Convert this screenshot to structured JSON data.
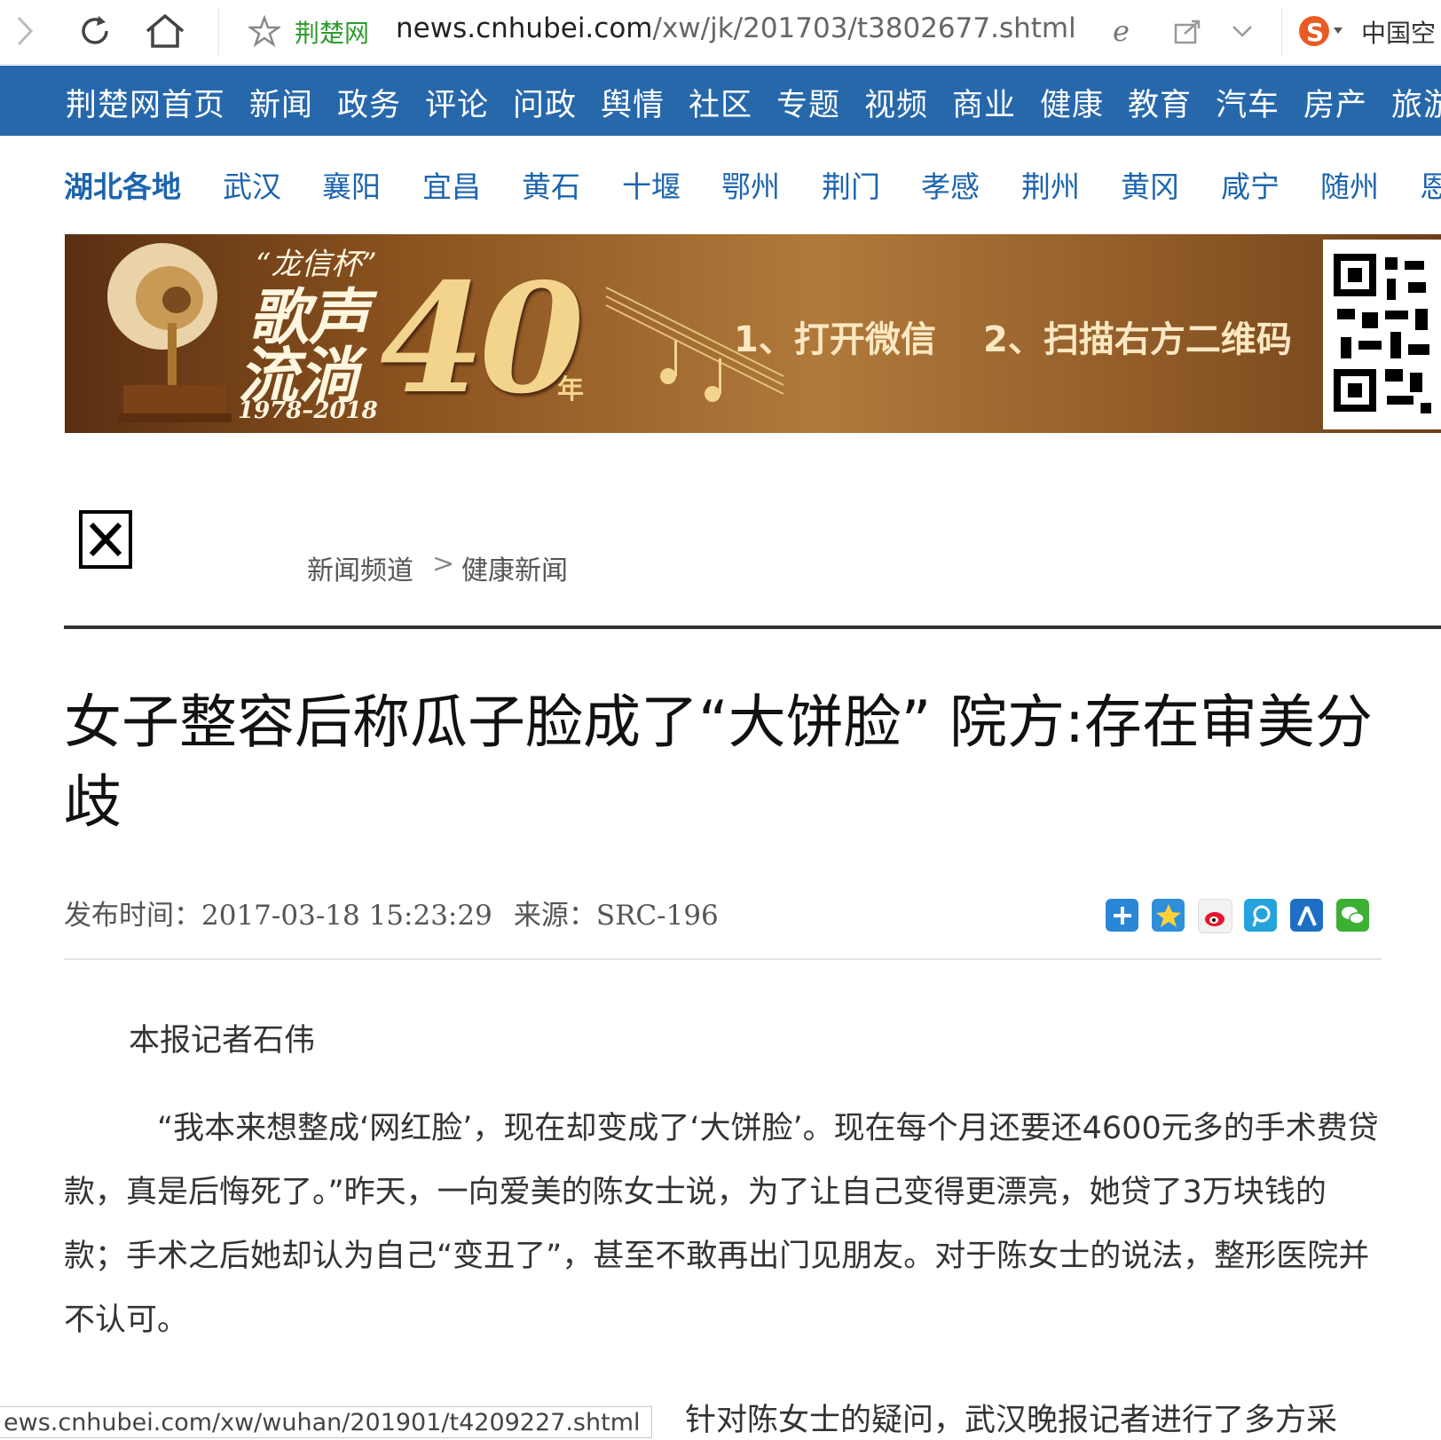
{
  "browser": {
    "site_name": "荆楚网",
    "url_host": "news.cnhubei.com",
    "url_path": "/xw/jk/201703/t3802677.shtml",
    "search_text": "中国空"
  },
  "main_nav": [
    "荆楚网首页",
    "新闻",
    "政务",
    "评论",
    "问政",
    "舆情",
    "社区",
    "专题",
    "视频",
    "商业",
    "健康",
    "教育",
    "汽车",
    "房产",
    "旅游"
  ],
  "region_nav": {
    "title": "湖北各地",
    "items": [
      "武汉",
      "襄阳",
      "宜昌",
      "黄石",
      "十堰",
      "鄂州",
      "荆门",
      "孝感",
      "荆州",
      "黄冈",
      "咸宁",
      "随州",
      "恩"
    ]
  },
  "banner": {
    "cup": "“龙信杯”",
    "slogan_1": "歌声",
    "slogan_2": "流淌",
    "years": "1978–2018",
    "big_number": "40",
    "nian": "年",
    "step_1": "1、打开微信",
    "step_2": "2、扫描右方二维码"
  },
  "breadcrumb": {
    "channel": "新闻频道",
    "separator": ">",
    "section": "健康新闻"
  },
  "article": {
    "title": "女子整容后称瓜子脸成了“大饼脸” 院方:存在审美分歧",
    "publish_label": "发布时间：",
    "publish_time": "2017-03-18 15:23:29",
    "source_label": "来源：",
    "source": "SRC-196",
    "byline": "本报记者石伟",
    "paragraph_1": "“我本来想整成‘网红脸’，现在却变成了‘大饼脸’。现在每个月还要还4600元多的手术费贷款，真是后悔死了。”昨天，一向爱美的陈女士说，为了让自己变得更漂亮，她贷了3万块钱的款；手术之后她却认为自己“变丑了”，甚至不敢再出门见朋友。对于陈女士的说法，整形医院并不认可。",
    "paragraph_2_partial": "针对陈女士的疑问，武汉晚报记者进行了多方采"
  },
  "share_icons": [
    "share-plus-icon",
    "qzone-icon",
    "weibo-icon",
    "tencent-icon",
    "renren-icon",
    "wechat-icon"
  ],
  "status_bar": {
    "link": "ews.cnhubei.com/xw/wuhan/201901/t4209227.shtml"
  },
  "colors": {
    "nav_blue": "#2768ab",
    "region_blue": "#1c64ae",
    "site_green": "#2e9b2e"
  }
}
